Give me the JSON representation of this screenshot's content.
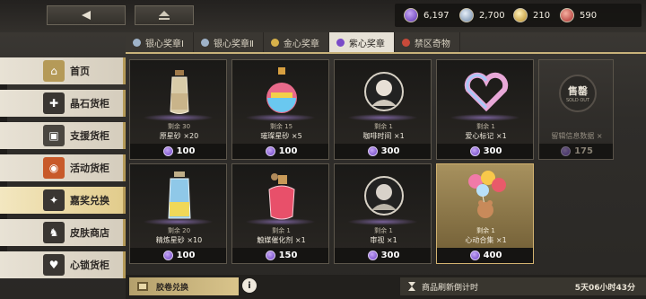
{
  "currencies": [
    {
      "icon": "purple-gem-icon",
      "value": "6,197",
      "color": "#7b4fd0"
    },
    {
      "icon": "silver-gem-icon",
      "value": "2,700",
      "color": "#9ab0c8"
    },
    {
      "icon": "gold-gem-icon",
      "value": "210",
      "color": "#d8b548"
    },
    {
      "icon": "red-gem-icon",
      "value": "590",
      "color": "#c84848"
    }
  ],
  "tabs": [
    {
      "label": "银心奖章Ⅰ",
      "color": "#9fb3c9",
      "active": false
    },
    {
      "label": "银心奖章Ⅱ",
      "color": "#9fb3c9",
      "active": false
    },
    {
      "label": "金心奖章",
      "color": "#d7b14a",
      "active": false
    },
    {
      "label": "紫心奖章",
      "color": "#7a4bc8",
      "active": true
    },
    {
      "label": "禁区奇物",
      "color": "#c84a3a",
      "active": false
    }
  ],
  "sidebar": {
    "items": [
      {
        "label": "首页",
        "icon": "home-icon",
        "color": "#b59a58"
      },
      {
        "label": "晶石货柜",
        "icon": "crystal-icon",
        "color": "#3a3632"
      },
      {
        "label": "支援货柜",
        "icon": "support-box-icon",
        "color": "#4a4640"
      },
      {
        "label": "活动货柜",
        "icon": "event-icon",
        "color": "#c85a2a"
      },
      {
        "label": "嘉奖兑换",
        "icon": "reward-icon",
        "color": "#3a3632"
      },
      {
        "label": "皮肤商店",
        "icon": "skin-icon",
        "color": "#3a3632"
      },
      {
        "label": "心锁货柜",
        "icon": "heart-lock-icon",
        "color": "#3a3632"
      }
    ]
  },
  "shop": {
    "items": [
      {
        "remain": "剩余 30",
        "name": "原星砂 ×20",
        "price": "100",
        "art": "sand-bottle-icon"
      },
      {
        "remain": "剩余 15",
        "name": "璀璨星砂 ×5",
        "price": "100",
        "art": "rainbow-bottle-icon"
      },
      {
        "remain": "剩余 1",
        "name": "咖啡时间 ×1",
        "price": "300",
        "art": "portrait-badge-icon"
      },
      {
        "remain": "剩余 1",
        "name": "爱心标记 ×1",
        "price": "300",
        "art": "heart-frame-icon"
      },
      {
        "remain": "",
        "name": "留辑信息数据 ×",
        "price": "175",
        "art": "sold-out-badge-icon"
      },
      {
        "remain": "剩余 20",
        "name": "精炼星砂 ×10",
        "price": "100",
        "art": "crystal-bottle-icon"
      },
      {
        "remain": "剩余 1",
        "name": "触媒催化剂 ×1",
        "price": "150",
        "art": "perfume-bottle-icon"
      },
      {
        "remain": "剩余 1",
        "name": "审视 ×1",
        "price": "300",
        "art": "portrait-badge-icon"
      },
      {
        "remain": "剩余 1",
        "name": "心动合集 ×1",
        "price": "400",
        "art": "balloon-bear-icon"
      }
    ],
    "sold_out_big": "售罄",
    "sold_out_small": "SOLD OUT"
  },
  "bottom": {
    "voucher_label": "胶卷兑换",
    "info_glyph": "i",
    "refresh_label": "商品刷新倒计时",
    "refresh_time": "5天06小时43分"
  }
}
